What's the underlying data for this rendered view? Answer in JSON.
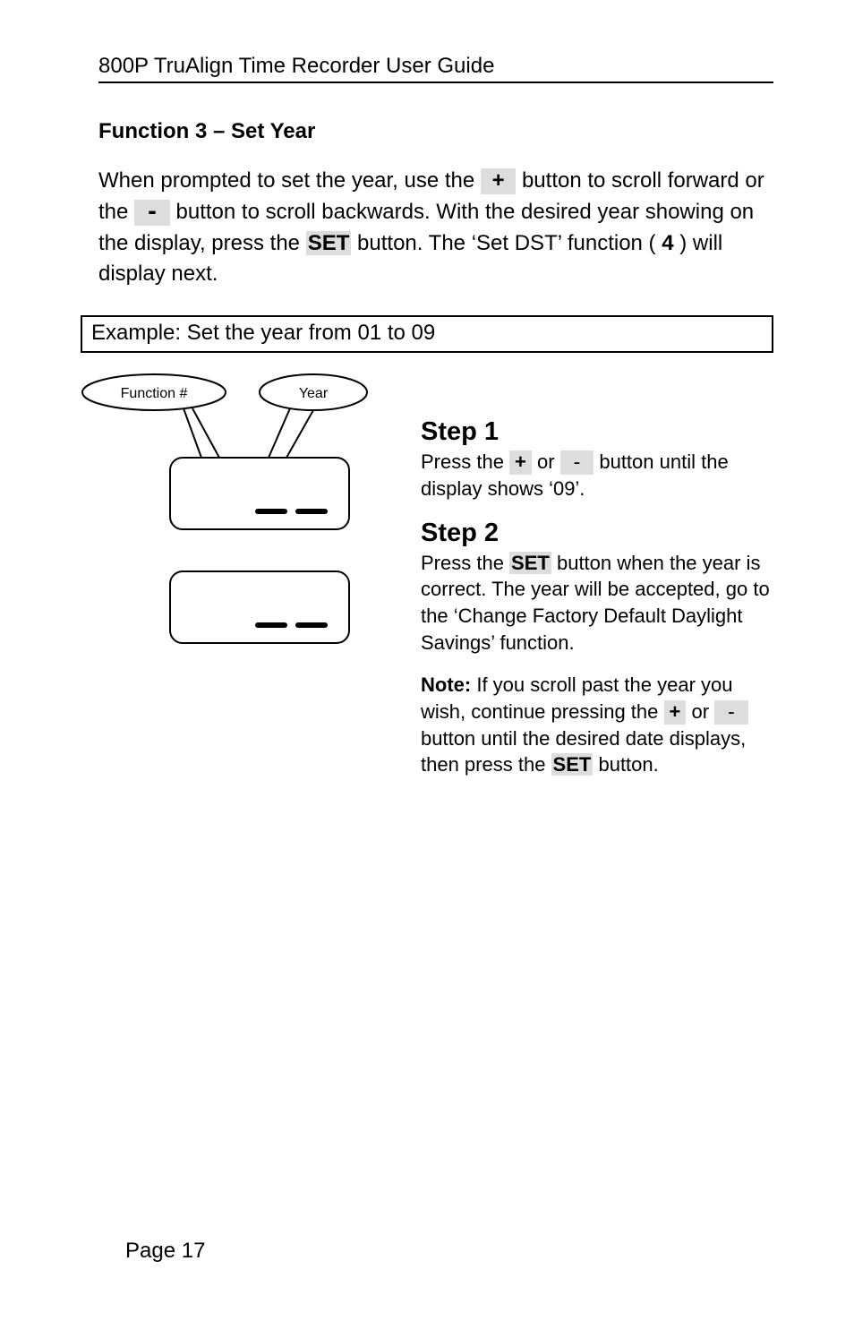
{
  "header": {
    "title": "800P TruAlign Time Recorder User Guide"
  },
  "section": {
    "title": "Function 3 – Set Year",
    "intro_part1": "When prompted to set the year, use the ",
    "plus": "+",
    "intro_part2": " button to scroll forward or the ",
    "minus": "-",
    "intro_part3": " button to scroll backwards. With the desired year showing on the display, press the ",
    "set": "SET",
    "intro_part4": " button. The ‘Set DST’ function (",
    "func_no": "4",
    "intro_part5": ") will display next."
  },
  "example": {
    "label": "Example: Set the year from 01 to 09"
  },
  "callouts": {
    "function_no": "Function #",
    "year": "Year"
  },
  "steps": {
    "s1_title": "Step 1",
    "s1_a": "Press the ",
    "s1_plus": "+",
    "s1_or": " or ",
    "s1_minus": "-",
    "s1_b": " button until the display shows ‘09’.",
    "s2_title": "Step 2",
    "s2_a": "Press the ",
    "s2_set": "SET",
    "s2_b": " button when the year is correct. The year will be accepted, go to the ‘Change Factory Default Daylight Savings’ function.",
    "note_label": "Note:",
    "note_a": " If you scroll past the year you wish, continue pressing the ",
    "note_plus": "+",
    "note_or": " or ",
    "note_minus": "-",
    "note_b": " button until the desired date displays, then press the ",
    "note_set": "SET",
    "note_c": " button."
  },
  "footer": {
    "page": "Page 17"
  }
}
